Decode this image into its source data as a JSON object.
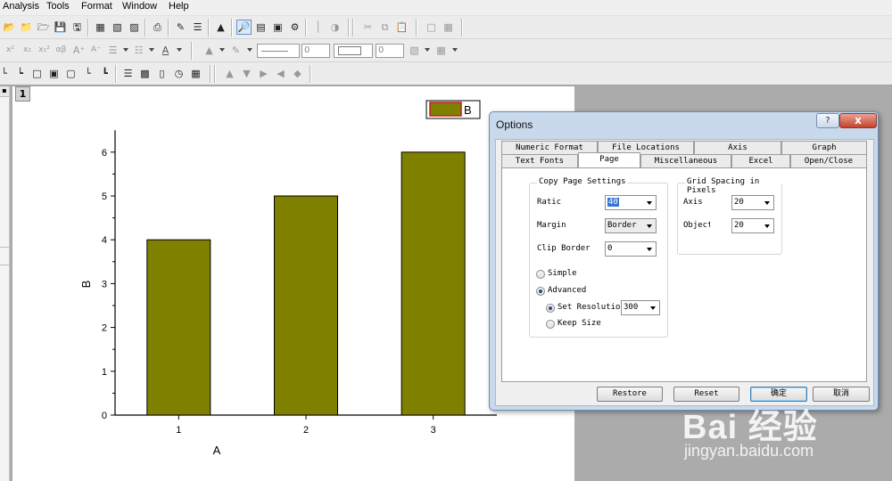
{
  "menubar": {
    "items": [
      "Analysis",
      "Tools",
      "Format",
      "Window",
      "Help"
    ]
  },
  "toolbar": {
    "font_size_value": "0",
    "line_width_value": "0"
  },
  "graph": {
    "layer_number": "1"
  },
  "chart_data": {
    "type": "bar",
    "categories": [
      "1",
      "2",
      "3"
    ],
    "series": [
      {
        "name": "B",
        "values": [
          4,
          5,
          6
        ]
      }
    ],
    "xlabel": "A",
    "ylabel": "B",
    "ylim": [
      0,
      6.5
    ],
    "yticks": [
      "0",
      "1",
      "2",
      "3",
      "4",
      "5",
      "6"
    ],
    "bar_color": "#808000",
    "legend_placement": "top-right",
    "grid": false
  },
  "dialog": {
    "title": "Options",
    "help_label": "?",
    "close_label": "x",
    "tabs_row1": [
      "Numeric Format",
      "File Locations",
      "Axis",
      "Graph"
    ],
    "tabs_row2": [
      "Text Fonts",
      "Page",
      "Miscellaneous",
      "Excel",
      "Open/Close"
    ],
    "active_tab": "Page",
    "copy_page": {
      "title": "Copy Page Settings",
      "ratio_label": "Ratic",
      "ratio_value": "40",
      "margin_label": "Margin",
      "margin_value": "Border",
      "clip_label": "Clip Border",
      "clip_value": "0",
      "simple_label": "Simple",
      "advanced_label": "Advanced",
      "set_res_label": "Set Resolutior",
      "set_res_value": "300",
      "keep_size_label": "Keep Size"
    },
    "grid_spacing": {
      "title": "Grid Spacing in Pixels",
      "axis_label": "Axis",
      "axis_value": "20",
      "object_label": "Object",
      "object_value": "20"
    },
    "buttons": {
      "restore": "Restore",
      "reset": "Reset",
      "ok": "确定",
      "cancel": "取消"
    }
  },
  "watermark": {
    "logo": "Bai 经验",
    "url": "jingyan.baidu.com"
  },
  "colors": {
    "bar_fill": "#808000",
    "desktop_gray": "#ababab",
    "dialog_frame": "#c9d9ec"
  }
}
